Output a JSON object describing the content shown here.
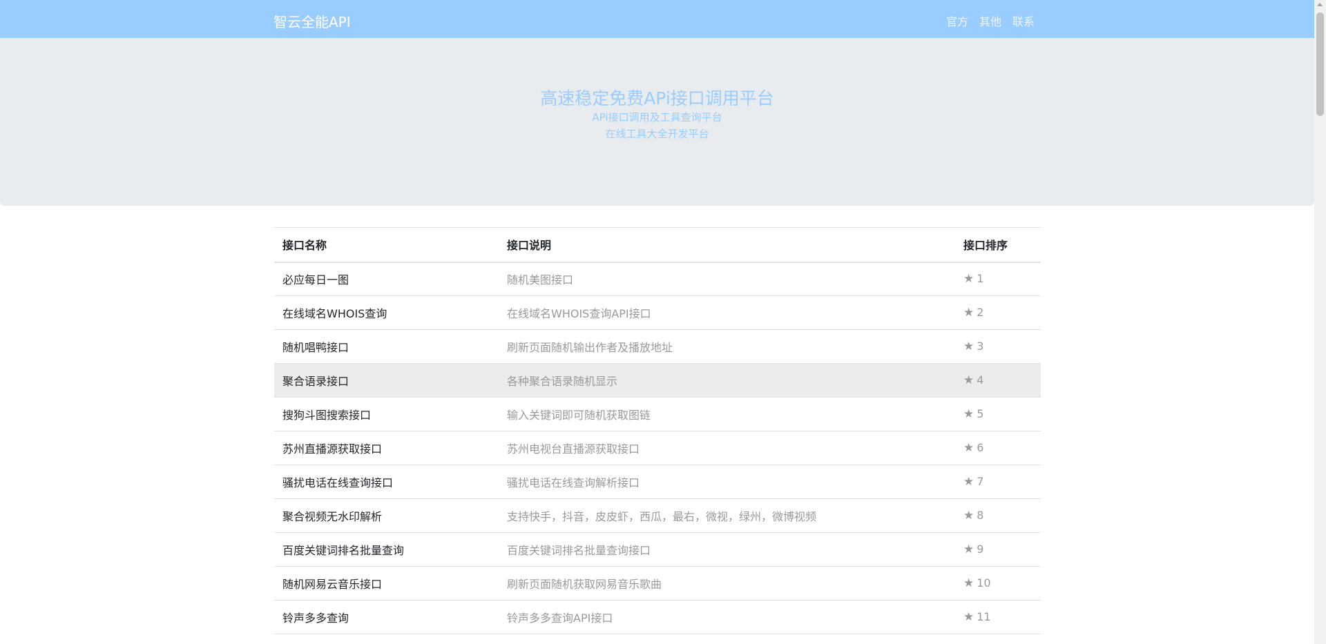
{
  "navbar": {
    "brand": "智云全能API",
    "links": [
      "官方",
      "其他",
      "联系"
    ]
  },
  "hero": {
    "title": "高速稳定免费APi接口调用平台",
    "subtitle1": "APi接口调用及工具查询平台",
    "subtitle2": "在线工具大全开发平台"
  },
  "table": {
    "headers": [
      "接口名称",
      "接口说明",
      "接口排序"
    ],
    "rows": [
      {
        "name": "必应每日一图",
        "desc": "随机美图接口",
        "rank": "1"
      },
      {
        "name": "在线域名WHOIS查询",
        "desc": "在线域名WHOIS查询API接口",
        "rank": "2"
      },
      {
        "name": "随机唱鸭接口",
        "desc": "刷新页面随机输出作者及播放地址",
        "rank": "3"
      },
      {
        "name": "聚合语录接口",
        "desc": "各种聚合语录随机显示",
        "rank": "4"
      },
      {
        "name": "搜狗斗图搜索接口",
        "desc": "输入关键词即可随机获取图链",
        "rank": "5"
      },
      {
        "name": "苏州直播源获取接口",
        "desc": "苏州电视台直播源获取接口",
        "rank": "6"
      },
      {
        "name": "骚扰电话在线查询接口",
        "desc": "骚扰电话在线查询解析接口",
        "rank": "7"
      },
      {
        "name": "聚合视频无水印解析",
        "desc": "支持快手，抖音，皮皮虾，西瓜，最右，微视，绿州，微博视频",
        "rank": "8"
      },
      {
        "name": "百度关键词排名批量查询",
        "desc": "百度关键词排名批量查询接口",
        "rank": "9"
      },
      {
        "name": "随机网易云音乐接口",
        "desc": "刷新页面随机获取网易音乐歌曲",
        "rank": "10"
      },
      {
        "name": "铃声多多查询",
        "desc": "铃声多多查询API接口",
        "rank": "11"
      }
    ]
  },
  "colors": {
    "navbar_bg": "#99ccff",
    "hero_bg": "#e9ecef",
    "accent_text": "#99ccff",
    "muted_text": "#999999"
  },
  "icons": {
    "rank": "star-icon"
  }
}
